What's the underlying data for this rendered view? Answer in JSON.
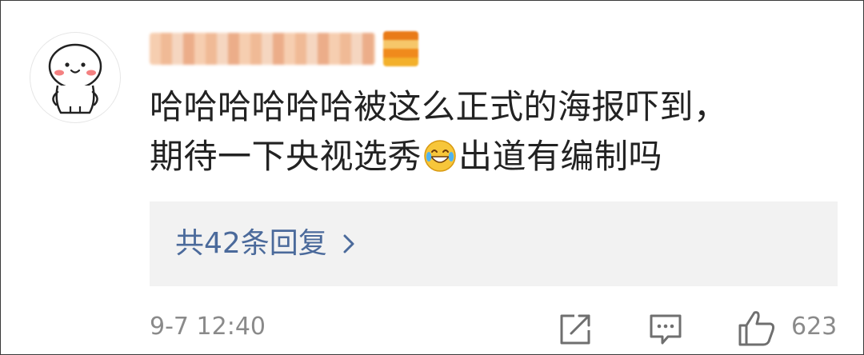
{
  "comment": {
    "text_line1": "哈哈哈哈哈哈被这么正式的海报吓到，",
    "text_line2_part1": "期待一下央视选秀",
    "text_line2_part2": "出道有编制吗",
    "emoji_icon": "laughing-tears-emoji"
  },
  "replies": {
    "label": "共42条回复",
    "chevron_icon": "chevron-right-icon"
  },
  "footer": {
    "timestamp": "9-7 12:40",
    "share_icon": "share-icon",
    "comment_icon": "comment-icon",
    "like_icon": "thumbs-up-icon",
    "like_count": "623"
  },
  "colors": {
    "link": "#4b6a9b",
    "meta": "#8a8a8a",
    "text": "#222222",
    "reply_bg": "#f2f2f2"
  }
}
